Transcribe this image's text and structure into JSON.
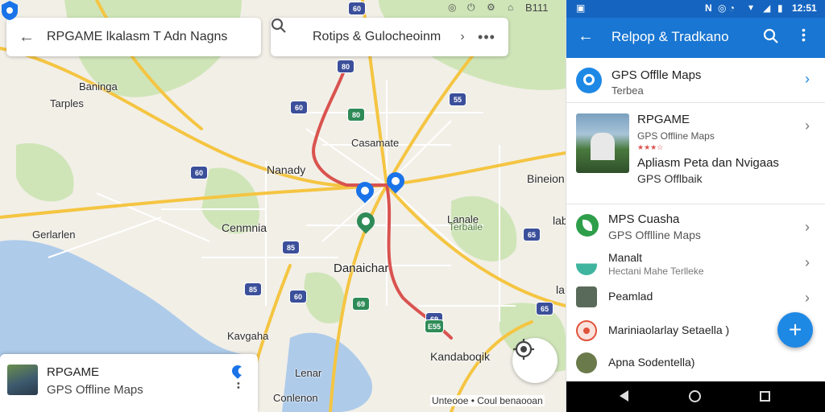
{
  "map": {
    "search_left": "RPGAME lkalasm T Adn Nagns",
    "search_right": "Rotips & Gulocheoinm",
    "places": [
      {
        "id": "baninga",
        "label": "Baninga"
      },
      {
        "id": "tarples",
        "label": "Tarples"
      },
      {
        "id": "casamate",
        "label": "Casamate"
      },
      {
        "id": "nanady",
        "label": "Nanady"
      },
      {
        "id": "cenmnia",
        "label": "Cenmnia"
      },
      {
        "id": "gerlarlen",
        "label": "Gerlarlen"
      },
      {
        "id": "lanale",
        "label": "Lanale"
      },
      {
        "id": "terbaile",
        "label": "Terbaile"
      },
      {
        "id": "danaichar",
        "label": "Danaichar"
      },
      {
        "id": "kavgaha",
        "label": "Kavgaha"
      },
      {
        "id": "lenar",
        "label": "Lenar"
      },
      {
        "id": "kandaboqik",
        "label": "Kandaboqik"
      },
      {
        "id": "conlenon",
        "label": "Conlenon"
      },
      {
        "id": "bineion",
        "label": "Bineion"
      },
      {
        "id": "la",
        "label": "la"
      },
      {
        "id": "iab",
        "label": "lab"
      }
    ],
    "shields": [
      "60",
      "80",
      "60",
      "55",
      "80",
      "60",
      "85",
      "65",
      "85",
      "60",
      "65",
      "69",
      "E55",
      "69",
      "65"
    ],
    "attribution": "Unteooe  •  Coul benaooan",
    "status_icons": [
      "sim-icon",
      "alarm-icon",
      "vibrate-icon",
      "wifi-icon"
    ],
    "status_time": "B111",
    "status_prefix": "0"
  },
  "place_card": {
    "title": "RPGAME",
    "subtitle": "GPS Offline Maps"
  },
  "panel": {
    "status_time": "12:51",
    "status_flag": "N",
    "title": "Relpop & Tradkano",
    "rows": [
      {
        "title": "GPS Offlle Maps",
        "subtitle": "Terbea"
      },
      {
        "title": "RPGAME",
        "subtitle": "GPS Offline Maps",
        "stars": "★★★☆",
        "desc": "Apliasm Peta dan Nvigaas",
        "desc2": "GPS Offlbaik"
      },
      {
        "title": "MPS Cuasha",
        "subtitle": "GPS Offlline Maps"
      },
      {
        "title": "Manalt",
        "subtitle": "Hectani Mahe Terlleke"
      },
      {
        "title": "Peamlad",
        "subtitle": ""
      },
      {
        "title": "Mariniaolarlay Setaella )",
        "subtitle": ""
      },
      {
        "title": "Apna Sodentella)",
        "subtitle": ""
      }
    ]
  },
  "colors": {
    "appbar": "#1976d2",
    "statusbar": "#1565c0",
    "fab": "#1e88e5",
    "water": "#aecbea",
    "park": "#cfe5b8",
    "highway": "#f5c542",
    "route": "#d9534f"
  }
}
